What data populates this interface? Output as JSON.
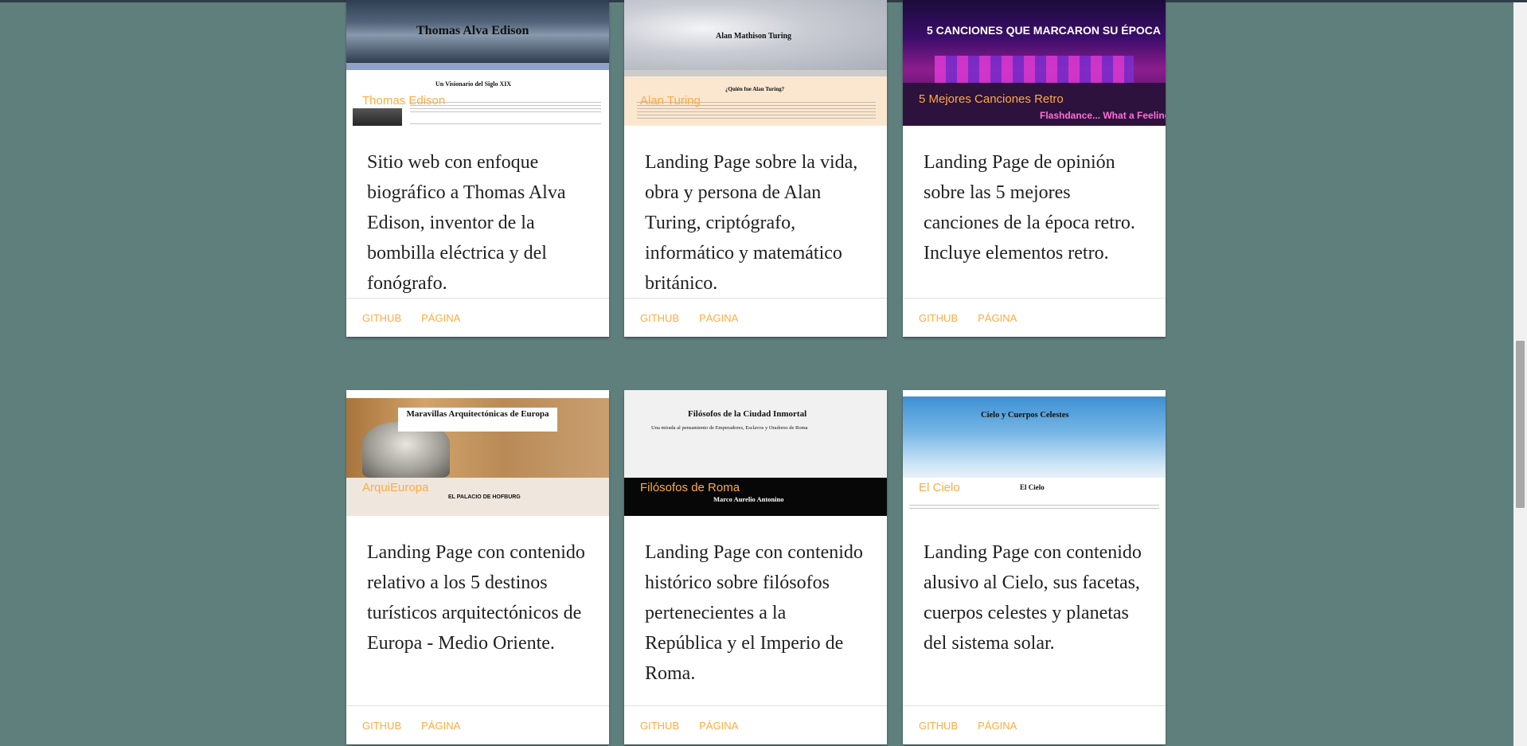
{
  "cards": [
    {
      "image_title": "Thomas Edison",
      "mock": {
        "heading": "Thomas Alva Edison",
        "subheading": "Un Visionario del Siglo XIX"
      },
      "description": "Sitio web con enfoque biográfico a Thomas Alva Edison, inventor de la bombilla eléctrica y del fonógrafo.",
      "github": "GITHUB",
      "page": "PÁGINA"
    },
    {
      "image_title": "Alan Turing",
      "mock": {
        "heading": "Alan Mathison Turing",
        "subheading": "¿Quién fue Alan Turing?"
      },
      "description": "Landing Page sobre la vida, obra y persona de Alan Turing, criptógrafo, informático y matemático británico.",
      "github": "GITHUB",
      "page": "PÁGINA"
    },
    {
      "image_title": "5 Mejores Canciones Retro",
      "mock": {
        "heading": "5 CANCIONES QUE MARCARON SU ÉPOCA",
        "subheading": "Flashdance... What a Feeling"
      },
      "description": "Landing Page de opinión sobre las 5 mejores canciones de la época retro. Incluye elementos retro.",
      "github": "GITHUB",
      "page": "PÁGINA"
    },
    {
      "image_title": "ArquiEuropa",
      "mock": {
        "heading": "Maravillas Arquitectónicas de Europa",
        "subheading": "EL PALACIO DE HOFBURG"
      },
      "description": "Landing Page con contenido relativo a los 5 destinos turísticos arquitectónicos de Europa - Medio Oriente.",
      "github": "GITHUB",
      "page": "PÁGINA"
    },
    {
      "image_title": "Filósofos de Roma",
      "mock": {
        "heading": "Filósofos de la Ciudad Inmortal",
        "subheading": "Una mirada al pensamiento de Emperadores, Esclavos y Oradores de Roma",
        "caption": "Marco Aurelio Antonino"
      },
      "description": "Landing Page con contenido histórico sobre filósofos pertenecientes a la República y el Imperio de Roma.",
      "github": "GITHUB",
      "page": "PÁGINA"
    },
    {
      "image_title": "El Cielo",
      "mock": {
        "heading": "Cielo y Cuerpos Celestes",
        "subheading": "El Cielo"
      },
      "description": "Landing Page con contenido alusivo al Cielo, sus facetas, cuerpos celestes y planetas del sistema solar.",
      "github": "GITHUB",
      "page": "PÁGINA"
    }
  ],
  "colors": {
    "background": "#5f7f7d",
    "accent": "#ffab40",
    "card": "#ffffff",
    "text": "#212121"
  }
}
